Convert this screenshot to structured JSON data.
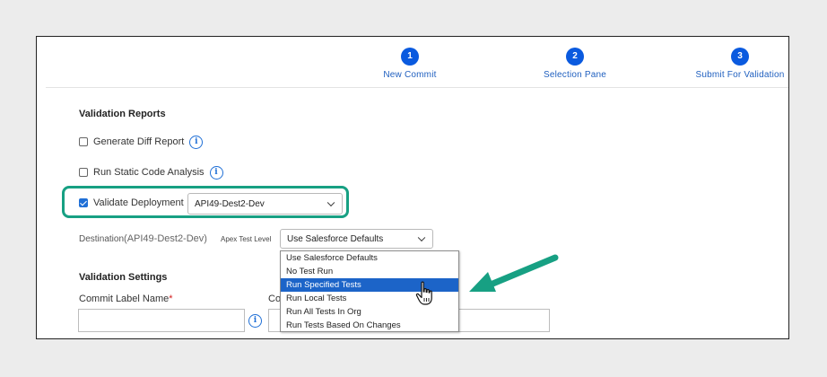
{
  "steps": [
    {
      "number": "1",
      "label": "New Commit"
    },
    {
      "number": "2",
      "label": "Selection Pane"
    },
    {
      "number": "3",
      "label": "Submit For Validation"
    }
  ],
  "validation_reports": {
    "title": "Validation Reports",
    "generate_diff": {
      "label": "Generate Diff Report",
      "checked": false
    },
    "static_code": {
      "label": "Run Static Code Analysis",
      "checked": false
    },
    "validate_deployment": {
      "label": "Validate Deployment",
      "checked": true,
      "selected_org": "API49-Dest2-Dev"
    }
  },
  "destination": {
    "label": "Destination",
    "value": "(API49-Dest2-Dev)"
  },
  "apex": {
    "label": "Apex Test Level",
    "selected": "Use Salesforce Defaults",
    "options": [
      "Use Salesforce Defaults",
      "No Test Run",
      "Run Specified Tests",
      "Run Local Tests",
      "Run All Tests In Org",
      "Run Tests Based On Changes"
    ],
    "highlighted_option": "Run Specified Tests"
  },
  "validation_settings": {
    "title": "Validation Settings",
    "commit_label": "Commit Label Name",
    "required_marker": "*",
    "second_label": "Co"
  },
  "icons": {
    "info": "info-icon",
    "cursor": "hand-pointer-icon",
    "annotation": "green-arrow-icon"
  },
  "colors": {
    "accent": "#0a5adf",
    "highlight": "#17a083",
    "selected_option": "#1c64c8",
    "required": "#d42020"
  }
}
